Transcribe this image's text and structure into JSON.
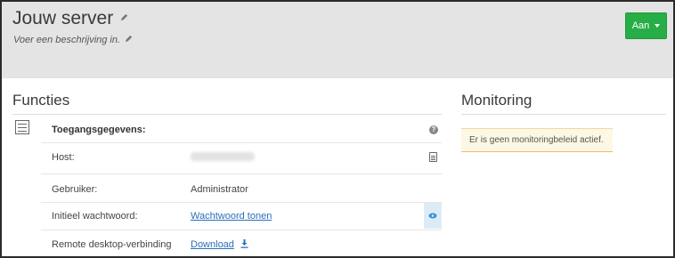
{
  "header": {
    "title": "Jouw server",
    "description": "Voer een beschrijving in.",
    "power_button": "Aan",
    "accent_color": "#27ae47"
  },
  "functions": {
    "title": "Functies",
    "section_heading": "Toegangsgegevens:",
    "rows": [
      {
        "label": "Host:",
        "value": "",
        "redacted": true
      },
      {
        "label": "Gebruiker:",
        "value": "Administrator"
      },
      {
        "label": "Initieel wachtwoord:",
        "value": "Wachtwoord tonen"
      },
      {
        "label": "Remote desktop-verbinding",
        "value": "Download"
      }
    ],
    "icons": [
      "list-icon",
      "help-icon",
      "copy-icon",
      "eye-icon",
      "download-icon"
    ]
  },
  "monitoring": {
    "title": "Monitoring",
    "alert": "Er is geen monitoringbeleid actief."
  }
}
